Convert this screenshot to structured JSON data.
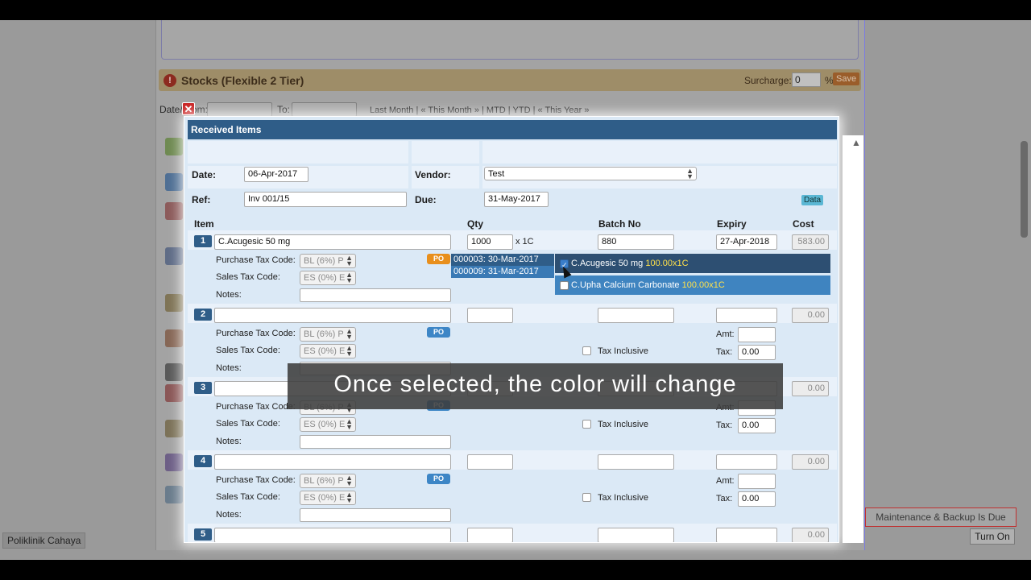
{
  "background": {
    "stocks_title": "Stocks (Flexible 2 Tier)",
    "surcharge_label": "Surcharge:",
    "surcharge_value": "0",
    "surcharge_unit": "%",
    "save_label": "Save",
    "date_from_label": "Date/From:",
    "to_label": "To:",
    "period_links": "Last Month | « This Month » | MTD | YTD | « This Year »",
    "clinic_name": "Poliklinik Cahaya",
    "maintenance_notice": "Maintenance & Backup Is Due",
    "turn_on_label": "Turn On"
  },
  "modal": {
    "title": "Received Items",
    "date_label": "Date:",
    "date_value": "06-Apr-2017",
    "vendor_label": "Vendor:",
    "vendor_value": "Test",
    "ref_label": "Ref:",
    "ref_value": "Inv 001/15",
    "due_label": "Due:",
    "due_value": "31-May-2017",
    "data_badge": "Data",
    "columns": {
      "item": "Item",
      "qty": "Qty",
      "batch": "Batch No",
      "expiry": "Expiry",
      "cost": "Cost"
    },
    "purchase_tax_label": "Purchase Tax Code:",
    "sales_tax_label": "Sales Tax Code:",
    "notes_label": "Notes:",
    "purchase_tax_value": "BL (6%) P",
    "sales_tax_value": "ES (0%) E",
    "po_label": "PO",
    "tax_inclusive_label": "Tax Inclusive",
    "amt_label": "Amt:",
    "tax_label": "Tax:",
    "rows": [
      {
        "num": "1",
        "item": "C.Acugesic 50 mg",
        "qty": "1000",
        "unit": "x 1C",
        "batch": "880",
        "expiry": "27-Apr-2018",
        "cost": "583.00"
      },
      {
        "num": "2",
        "item": "",
        "qty": "",
        "batch": "",
        "expiry": "",
        "cost": "0.00",
        "tax": "0.00"
      },
      {
        "num": "3",
        "item": "",
        "qty": "",
        "batch": "",
        "expiry": "",
        "cost": "0.00",
        "tax": "0.00"
      },
      {
        "num": "4",
        "item": "",
        "qty": "",
        "batch": "",
        "expiry": "",
        "cost": "0.00",
        "tax": "0.00"
      },
      {
        "num": "5",
        "item": "",
        "qty": "",
        "batch": "",
        "expiry": "",
        "cost": "0.00"
      }
    ]
  },
  "po_dropdown": [
    "000003: 30-Mar-2017",
    "000009: 31-Mar-2017"
  ],
  "item_dropdown": [
    {
      "name": "C.Acugesic 50 mg",
      "qty": "100.00x1C",
      "checked": true
    },
    {
      "name": "C.Upha Calcium Carbonate",
      "qty": "100.00x1C",
      "checked": false
    }
  ],
  "caption": "Once selected, the color will change"
}
